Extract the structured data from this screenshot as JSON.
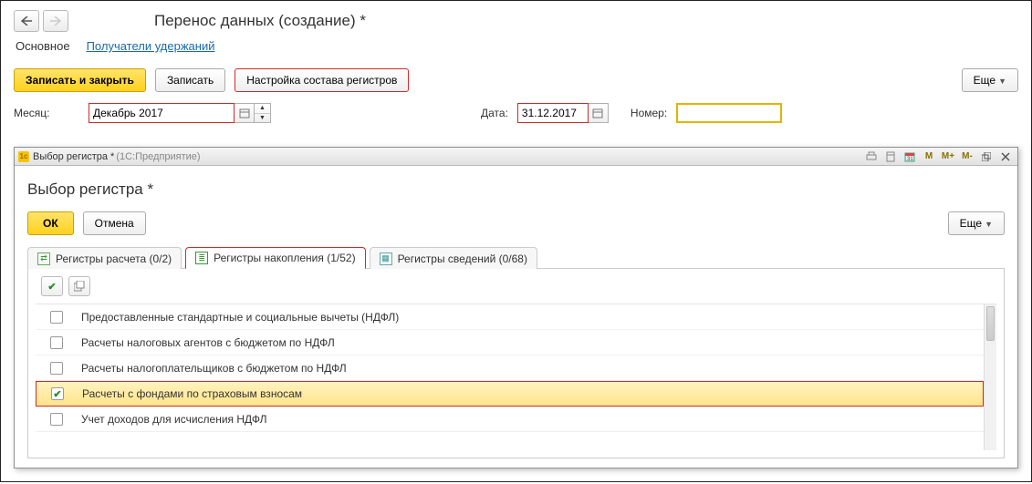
{
  "header": {
    "title": "Перенос данных (создание) *"
  },
  "tabs": {
    "main": "Основное",
    "recipients": "Получатели удержаний"
  },
  "toolbar": {
    "save_close": "Записать и закрыть",
    "save": "Записать",
    "configure": "Настройка состава регистров",
    "more": "Еще"
  },
  "fields": {
    "month_label": "Месяц:",
    "month_value": "Декабрь 2017",
    "date_label": "Дата:",
    "date_value": "31.12.2017",
    "number_label": "Номер:",
    "number_value": ""
  },
  "modal": {
    "titlebar": {
      "title": "Выбор регистра *",
      "sub": "(1С:Предприятие)",
      "m": "M",
      "mplus": "M+",
      "mminus": "M-"
    },
    "title": "Выбор регистра *",
    "ok": "ОК",
    "cancel": "Отмена",
    "more": "Еще",
    "subtabs": {
      "t1": "Регистры расчета (0/2)",
      "t2": "Регистры накопления (1/52)",
      "t3": "Регистры сведений (0/68)"
    },
    "rows": [
      {
        "checked": false,
        "text": "Предоставленные стандартные и социальные вычеты (НДФЛ)"
      },
      {
        "checked": false,
        "text": "Расчеты налоговых агентов с бюджетом по НДФЛ"
      },
      {
        "checked": false,
        "text": "Расчеты налогоплательщиков с бюджетом по НДФЛ"
      },
      {
        "checked": true,
        "text": "Расчеты с фондами по страховым взносам"
      },
      {
        "checked": false,
        "text": "Учет доходов для исчисления НДФЛ"
      }
    ]
  }
}
